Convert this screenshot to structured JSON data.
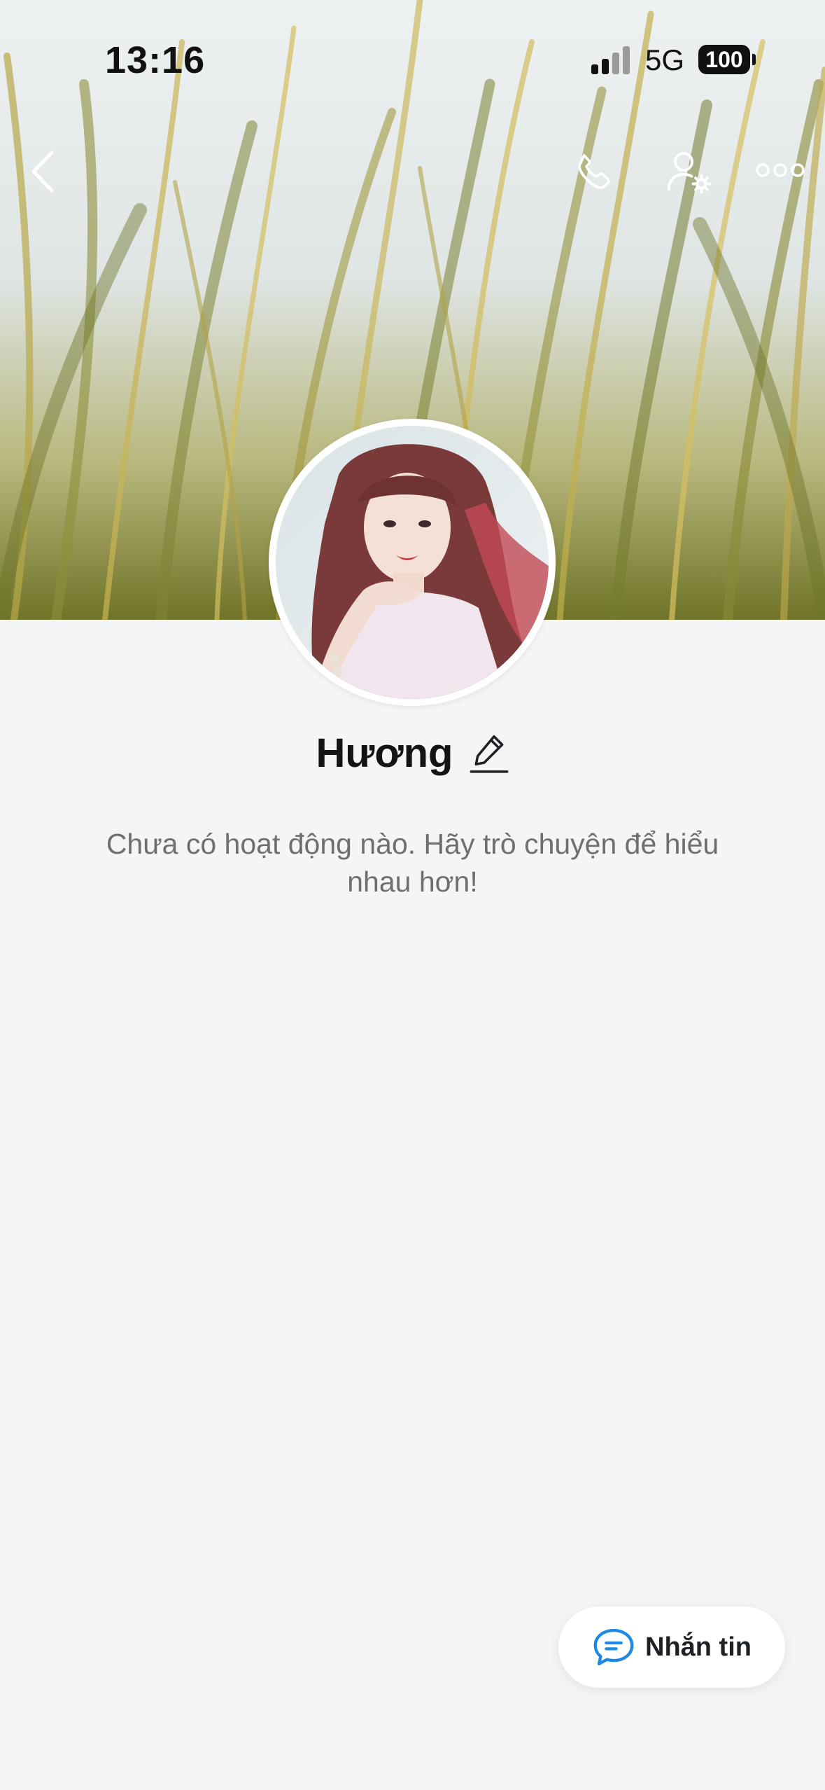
{
  "status_bar": {
    "time": "13:16",
    "network": "5G",
    "battery": "100"
  },
  "nav": {
    "back_icon": "chevron-left-icon",
    "call_icon": "phone-icon",
    "profile_settings_icon": "user-settings-icon",
    "more_icon": "more-dots-icon"
  },
  "profile": {
    "name": "Hương",
    "edit_icon": "pencil-icon",
    "empty_message": "Chưa có hoạt động nào. Hãy trò chuyện để hiểu nhau hơn!"
  },
  "actions": {
    "message_label": "Nhắn tin",
    "message_icon": "chat-bubble-icon"
  },
  "colors": {
    "accent": "#1e88e5",
    "background": "#f4f5f7",
    "text_primary": "#141414",
    "text_secondary": "#6d6f73"
  }
}
